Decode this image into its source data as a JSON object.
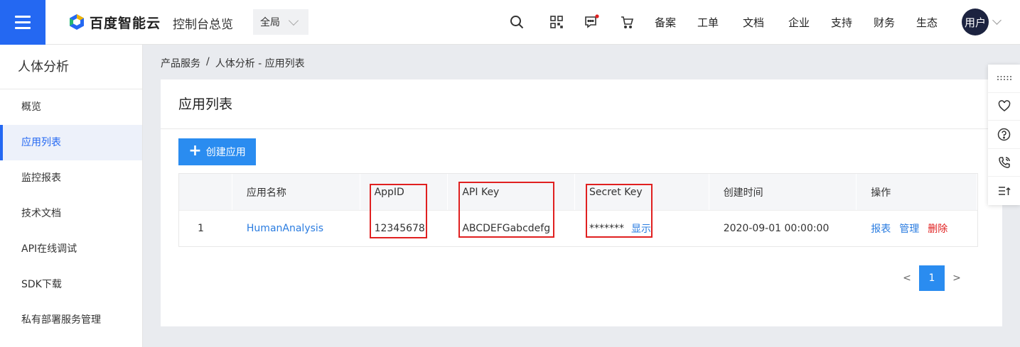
{
  "topbar": {
    "logo_text": "百度智能云",
    "console_title": "控制台总览",
    "scope_value": "全局",
    "nav_links": [
      "备案",
      "工单",
      "文档",
      "企业",
      "支持",
      "财务",
      "生态"
    ],
    "avatar_text": "用户",
    "message_dot_color": "#e02020"
  },
  "sidebar": {
    "title": "人体分析",
    "items": [
      {
        "label": "概览",
        "active": false
      },
      {
        "label": "应用列表",
        "active": true
      },
      {
        "label": "监控报表",
        "active": false
      },
      {
        "label": "技术文档",
        "active": false
      },
      {
        "label": "API在线调试",
        "active": false
      },
      {
        "label": "SDK下载",
        "active": false
      },
      {
        "label": "私有部署服务管理",
        "active": false
      }
    ]
  },
  "breadcrumb": {
    "root": "产品服务",
    "separator": "/",
    "current": "人体分析 - 应用列表"
  },
  "main": {
    "title": "应用列表",
    "create_button": "创建应用",
    "table": {
      "headers": [
        "",
        "应用名称",
        "AppID",
        "API Key",
        "Secret Key",
        "创建时间",
        "操作"
      ],
      "rows": [
        {
          "index": "1",
          "name": "HumanAnalysis",
          "app_id": "12345678",
          "api_key": "ABCDEFGabcdefg",
          "secret_key": "*******",
          "secret_show": "显示",
          "created": "2020-09-01 00:00:00",
          "actions": {
            "report": "报表",
            "manage": "管理",
            "delete": "删除"
          }
        }
      ]
    },
    "pagination": {
      "prev": "<",
      "current": "1",
      "next": ">"
    }
  },
  "colors": {
    "brand_blue": "#2468f2",
    "button_blue": "#2a8cf0",
    "link_blue": "#2a7ce0",
    "danger_red": "#e02020",
    "highlight_red": "#e02020"
  }
}
